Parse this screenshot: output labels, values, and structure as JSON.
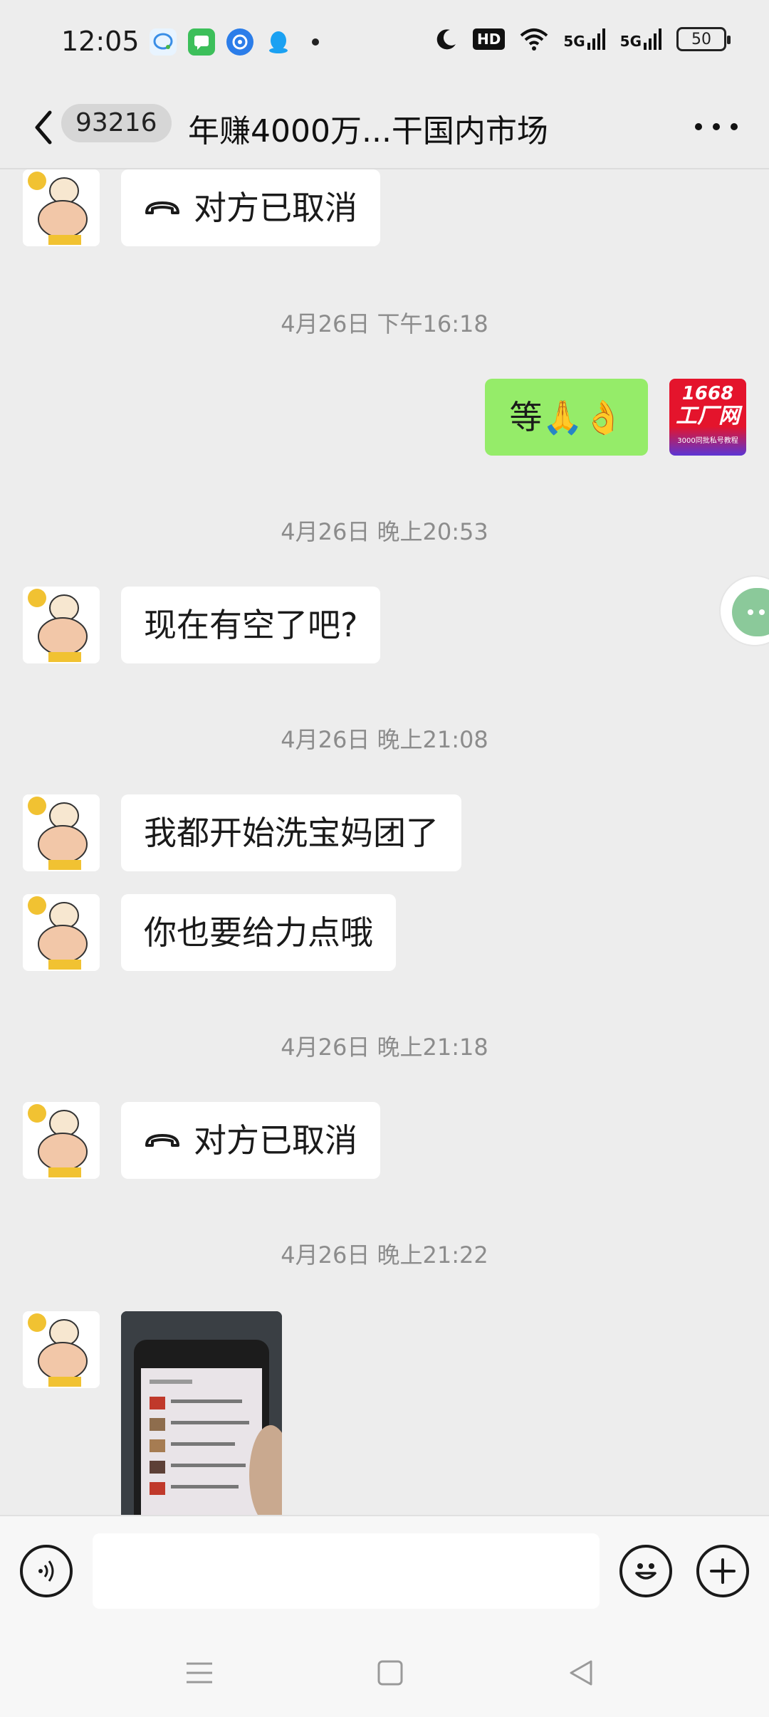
{
  "status_bar": {
    "time": "12:05",
    "network1": "5G",
    "network2": "5G",
    "hd_label": "HD",
    "battery": "50",
    "app_icons": [
      "chat-bubble-icon",
      "message-icon",
      "browser-icon",
      "qq-icon"
    ]
  },
  "header": {
    "unread_count": "93216",
    "title": "年赚4000万...干国内市场"
  },
  "messages": [
    {
      "type": "call",
      "side": "left",
      "text": "对方已取消"
    },
    {
      "type": "time",
      "text": "4月26日 下午16:18"
    },
    {
      "type": "text",
      "side": "right",
      "text": "等🙏👌"
    },
    {
      "type": "time",
      "text": "4月26日 晚上20:53"
    },
    {
      "type": "text",
      "side": "left",
      "text": "现在有空了吧?"
    },
    {
      "type": "time",
      "text": "4月26日 晚上21:08"
    },
    {
      "type": "text",
      "side": "left",
      "text": "我都开始洗宝妈团了"
    },
    {
      "type": "text",
      "side": "left",
      "text": "你也要给力点哦"
    },
    {
      "type": "time",
      "text": "4月26日 晚上21:18"
    },
    {
      "type": "call",
      "side": "left",
      "text": "对方已取消"
    },
    {
      "type": "time",
      "text": "4月26日 晚上21:22"
    },
    {
      "type": "image",
      "side": "left"
    }
  ],
  "self_avatar": {
    "line1": "1668",
    "line2": "工厂网",
    "line3": "3000同批私号教程"
  },
  "input": {
    "value": "",
    "placeholder": ""
  },
  "colors": {
    "background": "#ededed",
    "self_bubble": "#95ec69",
    "other_bubble": "#ffffff",
    "timestamp": "#8c8c8c"
  }
}
